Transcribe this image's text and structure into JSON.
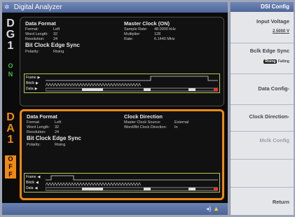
{
  "title_bar": {
    "title": "Digital Analyzer",
    "icon": "gear-icon"
  },
  "sidebar_g": {
    "letters": [
      "D",
      "G",
      "1"
    ],
    "bottom": [
      "O",
      "N"
    ]
  },
  "sidebar_a": {
    "letters": [
      "D",
      "A",
      "1"
    ],
    "bottom": [
      "O",
      "F",
      "F"
    ]
  },
  "dg1": {
    "data_format_heading": "Data Format",
    "rows": [
      {
        "label": "Format:",
        "value": "Left"
      },
      {
        "label": "Word Length:",
        "value": "32"
      },
      {
        "label": "Resolution:",
        "value": "24"
      }
    ],
    "bit_clock_heading": "Bit Clock Edge Sync",
    "polarity": {
      "label": "Polarity:",
      "value": "Rising"
    },
    "master_clock_heading": "Master Clock (ON)",
    "master_rows": [
      {
        "label": "Sample Rate:",
        "value": "48.0000 kHz"
      },
      {
        "label": "Multiplier:",
        "value": "128"
      },
      {
        "label": "Rate:",
        "value": "6.1440 MHz"
      }
    ],
    "timing_labels": [
      "Frame",
      "Bitclk",
      "Data"
    ]
  },
  "da1": {
    "data_format_heading": "Data Format",
    "rows": [
      {
        "label": "Format:",
        "value": "Left"
      },
      {
        "label": "Word Length:",
        "value": "32"
      },
      {
        "label": "Resolution:",
        "value": "24"
      }
    ],
    "bit_clock_heading": "Bit Clock Edge Sync",
    "polarity": {
      "label": "Polarity:",
      "value": "Rising"
    },
    "clock_direction_heading": "Clock Direction",
    "clock_rows": [
      {
        "label": "Master Clock Source:",
        "value": "External"
      },
      {
        "label": "Word/Bit Clock Direction:",
        "value": "In"
      }
    ],
    "timing_labels": [
      "Frame",
      "Bitclk",
      "Data"
    ]
  },
  "menu": {
    "title": "DSI Config",
    "input_voltage": {
      "label": "Input Voltage",
      "value": "2.5000 V"
    },
    "bclk_edge_sync": {
      "label": "Bclk Edge Sync",
      "on": "Rising",
      "off": "Falling"
    },
    "data_config": "Data Config-",
    "clock_direction": "Clock Direction-",
    "mclk_config": "Mclk Config",
    "return": "Return"
  },
  "colors": {
    "active": "#f08a0e",
    "on_green": "#3fbf3f",
    "off_orange": "#f08a0e",
    "title_blue": "#5a72a6"
  }
}
